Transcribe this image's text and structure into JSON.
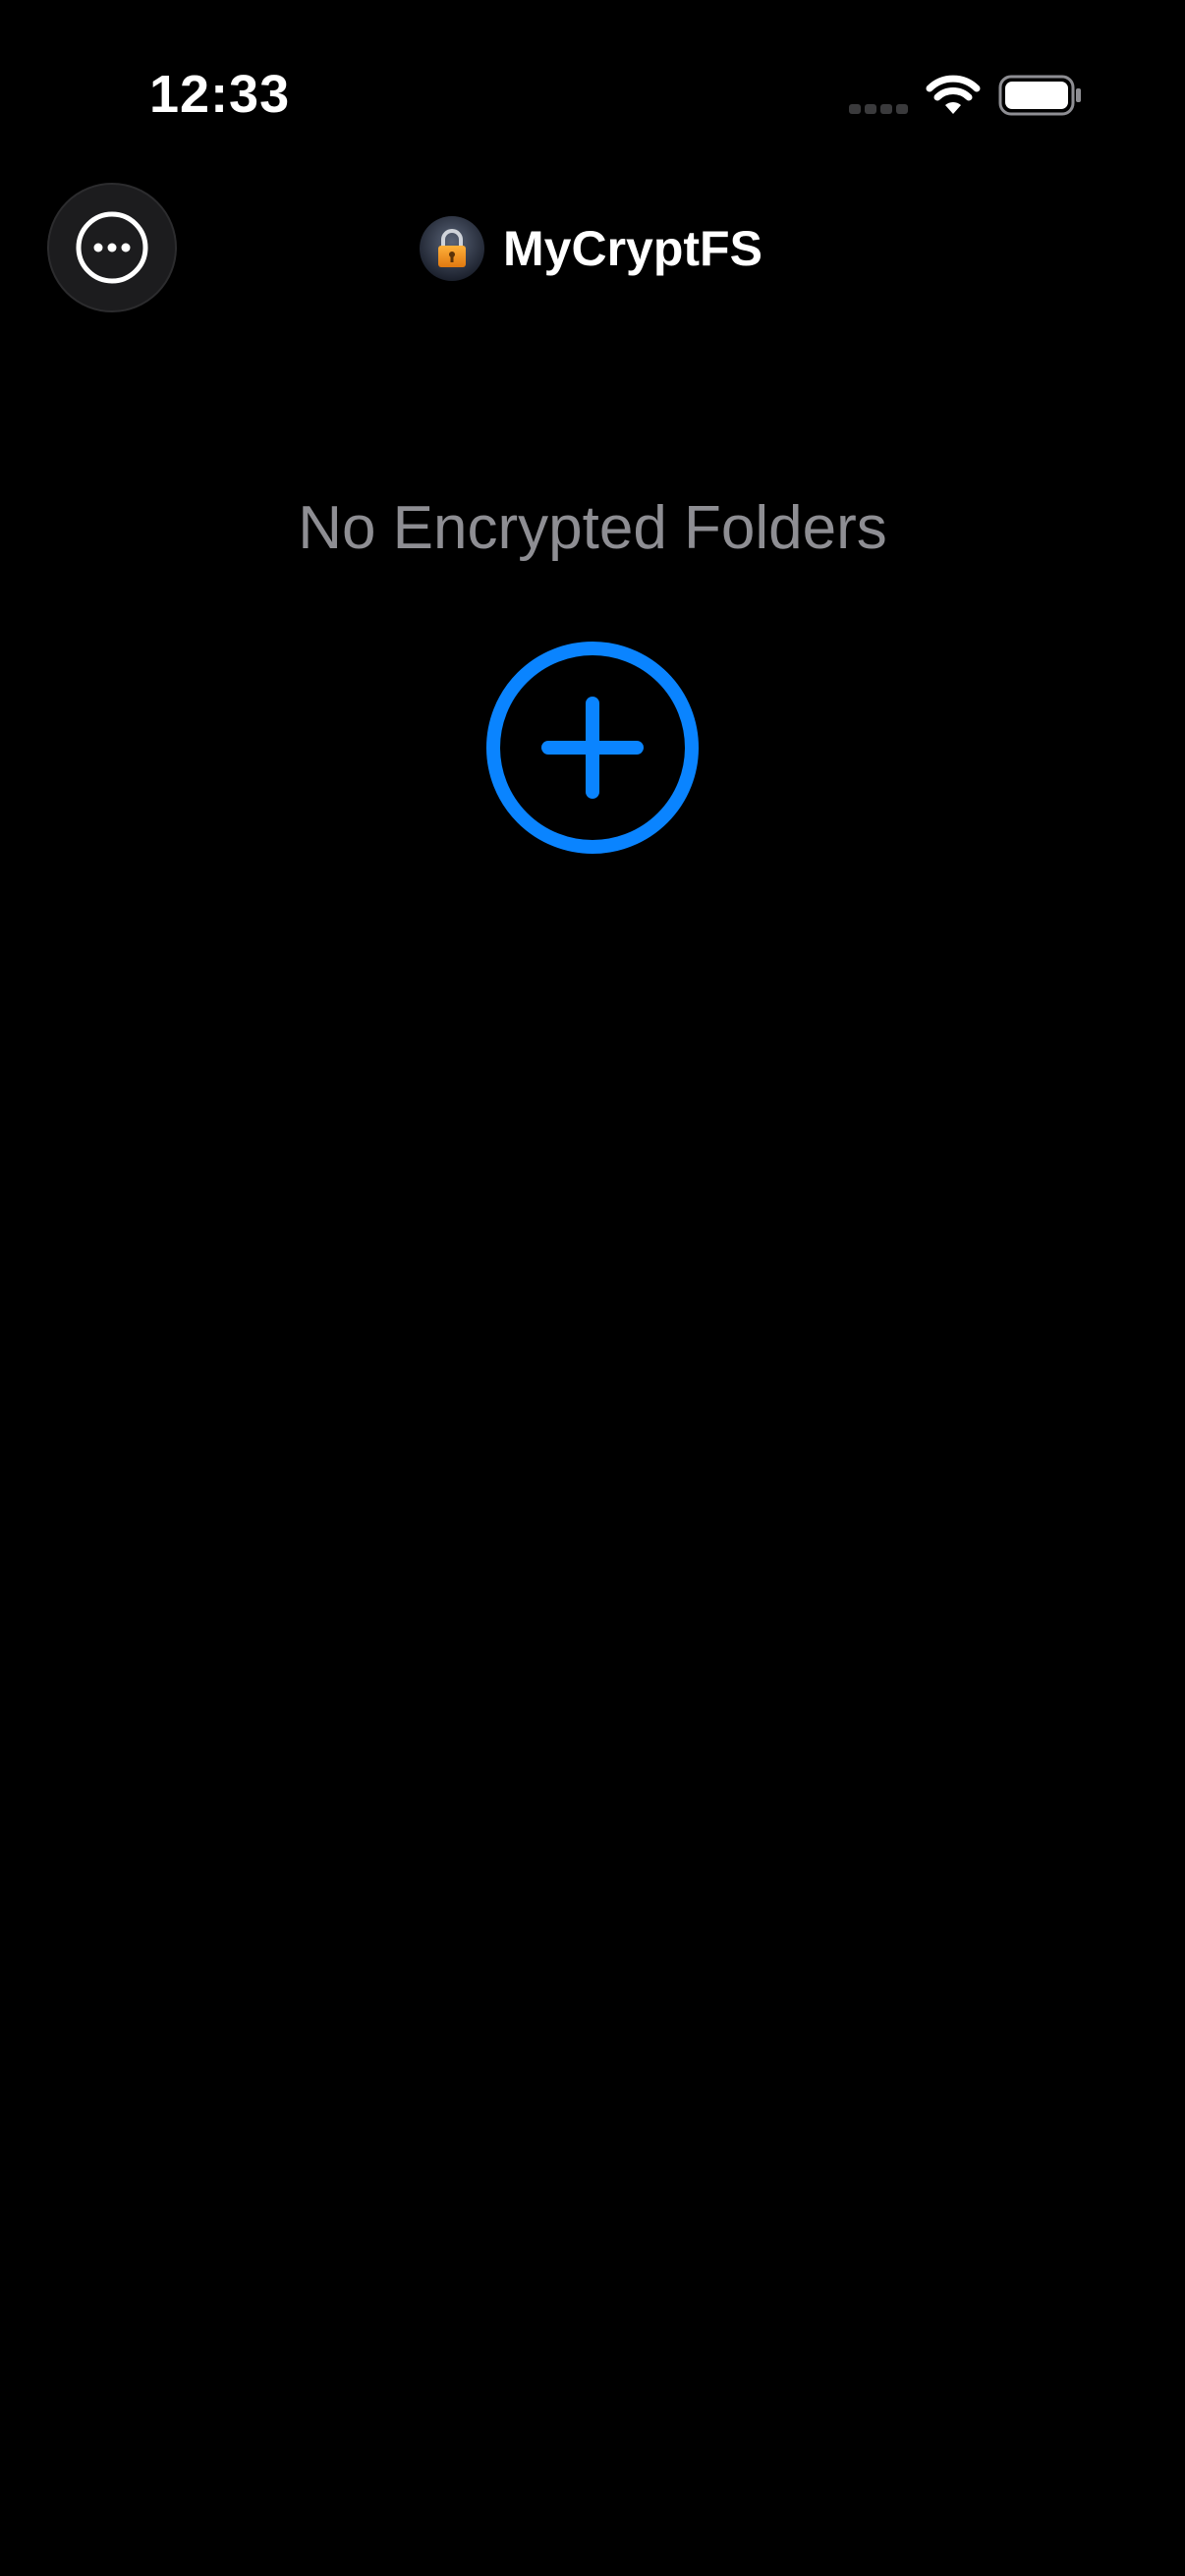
{
  "status_bar": {
    "time": "12:33",
    "signal_icon": "cellular-signal-icon",
    "wifi_icon": "wifi-icon",
    "battery_icon": "battery-icon"
  },
  "nav": {
    "more_icon": "ellipsis-circle-icon",
    "app_logo_icon": "padlock-icon",
    "title": "MyCryptFS"
  },
  "empty_state": {
    "message": "No Encrypted Folders",
    "add_icon": "plus-circle-icon"
  },
  "colors": {
    "background": "#000000",
    "accent": "#0a84ff",
    "secondary_text": "#8e8e93",
    "button_bg": "#1c1c1e"
  }
}
